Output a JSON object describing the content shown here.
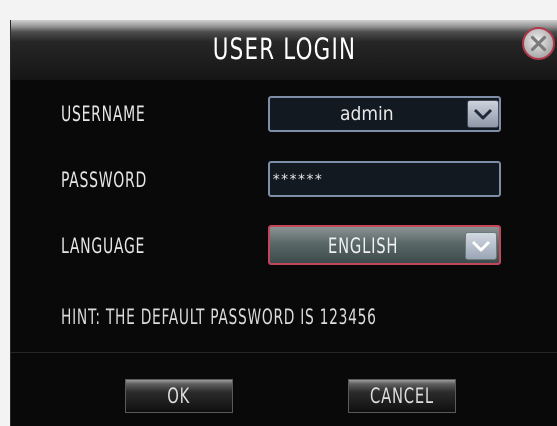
{
  "dialog": {
    "title": "USER LOGIN",
    "close_icon": "close-circle-icon"
  },
  "form": {
    "username_label": "USERNAME",
    "username_value": "admin",
    "password_label": "PASSWORD",
    "password_value": "******",
    "language_label": "LANGUAGE",
    "language_value": "ENGLISH",
    "dropdown_icon": "chevron-down-icon"
  },
  "hint": "HINT: THE DEFAULT PASSWORD IS 123456",
  "buttons": {
    "ok_label": "OK",
    "cancel_label": "CANCEL"
  },
  "colors": {
    "dialog_bg": "#090909",
    "field_border": "#7d8ea6",
    "language_border": "#c2475b"
  }
}
